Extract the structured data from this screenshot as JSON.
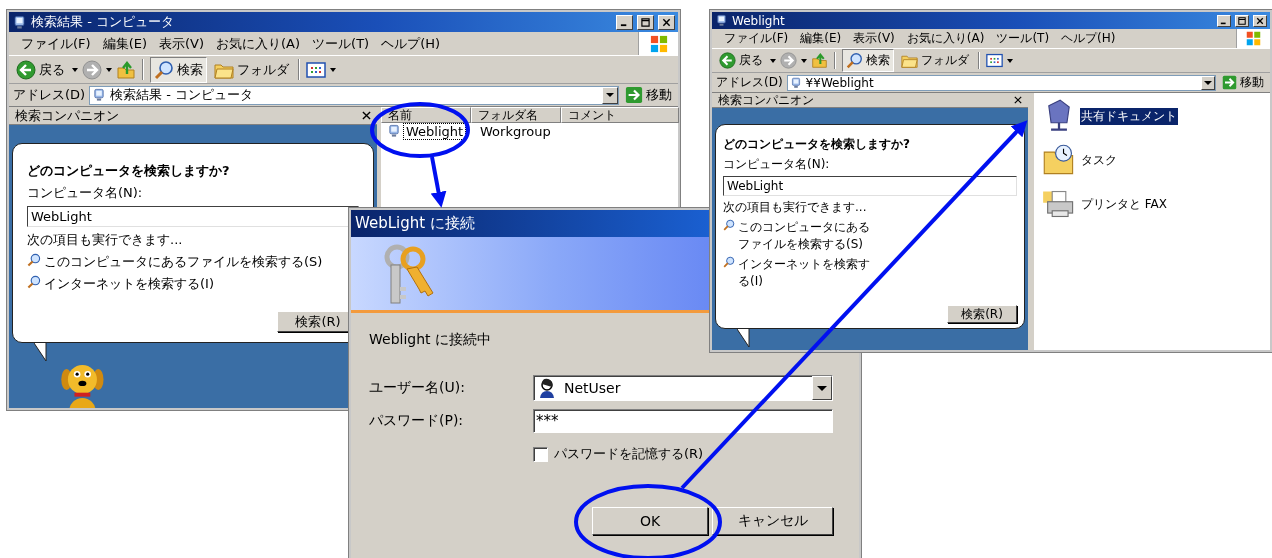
{
  "explorer_windows": [
    {
      "title": "検索結果 - コンピュータ",
      "menu": [
        "ファイル(F)",
        "編集(E)",
        "表示(V)",
        "お気に入り(A)",
        "ツール(T)",
        "ヘルプ(H)"
      ],
      "toolbar": {
        "back": "戻る",
        "search": "検索",
        "folders": "フォルダ"
      },
      "address": {
        "label": "アドレス(D)",
        "value": "検索結果 - コンピュータ",
        "go": "移動"
      },
      "companion": {
        "title": "検索コンパニオン",
        "heading": "どのコンピュータを検索しますか?",
        "field_label": "コンピュータ名(N):",
        "field_value": "WebLight",
        "hint": "次の項目も実行できます...",
        "links": [
          "このコンピュータにあるファイルを検索する(S)",
          "インターネットを検索する(I)"
        ],
        "button": "検索(R)"
      },
      "content": {
        "kind": "list",
        "columns": [
          "名前",
          "フォルダ名",
          "コメント"
        ],
        "rows": [
          {
            "cells": [
              "Weblight",
              "Workgroup"
            ],
            "selected": true
          }
        ]
      }
    },
    {
      "title": "Weblight",
      "menu": [
        "ファイル(F)",
        "編集(E)",
        "表示(V)",
        "お気に入り(A)",
        "ツール(T)",
        "ヘルプ(H)"
      ],
      "toolbar": {
        "back": "戻る",
        "search": "検索",
        "folders": "フォルダ"
      },
      "address": {
        "label": "アドレス(D)",
        "value": "¥¥Weblight",
        "go": "移動"
      },
      "companion": {
        "title": "検索コンパニオン",
        "heading": "どのコンピュータを検索しますか?",
        "field_label": "コンピュータ名(N):",
        "field_value": "WebLight",
        "hint": "次の項目も実行できます...",
        "links": [
          "このコンピュータにあるファイルを検索する(S)",
          "インターネットを検索する(I)"
        ],
        "button": "検索(R)"
      },
      "content": {
        "kind": "icons",
        "items": [
          {
            "label": "共有ドキュメント",
            "selected": true
          },
          {
            "label": "タスク",
            "selected": false
          },
          {
            "label": "プリンタと FAX",
            "selected": false
          }
        ]
      }
    }
  ],
  "dialog": {
    "title": "WebLight に接続",
    "message": "Weblight に接続中",
    "user_label": "ユーザー名(U):",
    "user_value": "NetUser",
    "password_label": "パスワード(P):",
    "password_value": "***",
    "remember": {
      "label": "パスワードを記憶する(R)",
      "checked": false
    },
    "buttons": [
      "OK",
      "キャンセル"
    ]
  }
}
